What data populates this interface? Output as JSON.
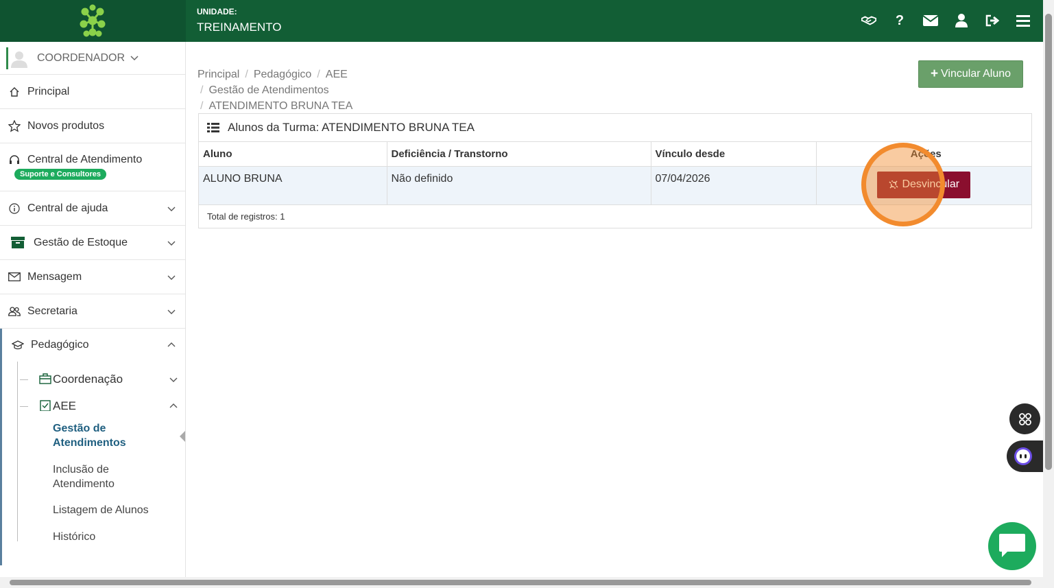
{
  "header": {
    "unit_label": "UNIDADE:",
    "unit_name": "TREINAMENTO",
    "icons": [
      "handshake-icon",
      "help-icon",
      "mail-icon",
      "user-icon",
      "logout-icon",
      "menu-icon"
    ],
    "help_glyph": "?"
  },
  "sidebar": {
    "user": "COORDENADOR",
    "items": [
      {
        "label": "Principal",
        "icon": "home-icon"
      },
      {
        "label": "Novos produtos",
        "icon": "star-icon"
      },
      {
        "label": "Central de Atendimento",
        "icon": "headset-icon",
        "badge": "Suporte e Consultores"
      },
      {
        "label": "Central de ajuda",
        "icon": "info-icon"
      },
      {
        "label": "Gestão de Estoque",
        "icon": "archive-icon"
      },
      {
        "label": "Mensagem",
        "icon": "envelope-icon"
      },
      {
        "label": "Secretaria",
        "icon": "people-icon"
      }
    ],
    "pedagogico": {
      "label": "Pedagógico",
      "sub": [
        {
          "label": "Coordenação"
        },
        {
          "label": "AEE"
        }
      ],
      "leaves": [
        "Gestão de Atendimentos",
        "Inclusão de Atendimento",
        "Listagem de Alunos",
        "Histórico"
      ]
    }
  },
  "breadcrumb": [
    "Principal",
    "Pedagógico",
    "AEE",
    "Gestão de Atendimentos",
    "ATENDIMENTO BRUNA TEA"
  ],
  "actions": {
    "vincular_label": "Vincular Aluno",
    "vincular_glyph": "+"
  },
  "panel": {
    "title": "Alunos da Turma: ATENDIMENTO BRUNA TEA",
    "columns": [
      "Aluno",
      "Deficiência / Transtorno",
      "Vínculo desde",
      "Ações"
    ],
    "rows": [
      {
        "aluno": "ALUNO BRUNA",
        "deficiencia": "Não definido",
        "vinculo": "07/04/2026",
        "action": "Desvincular"
      }
    ],
    "total": "Total de registros: 1"
  },
  "colors": {
    "header_green": "#125e35",
    "vincular_green": "#6aa06a",
    "desvincular_red": "#8a0f2e",
    "chat_green": "#1dab5d",
    "highlight_orange": "#f28b2e"
  }
}
